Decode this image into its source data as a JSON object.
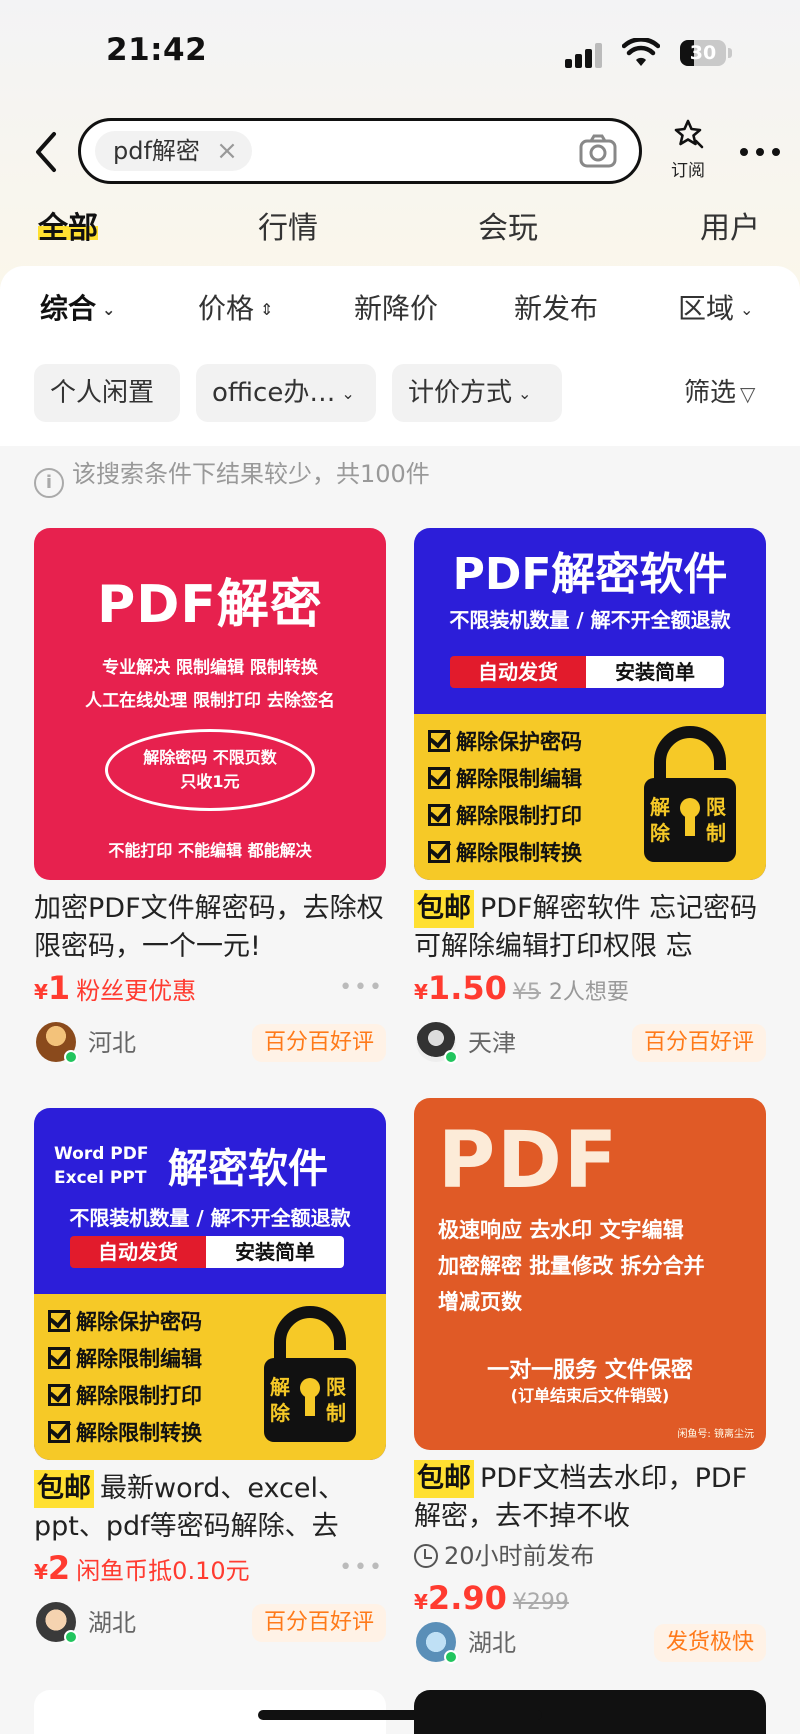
{
  "status_bar": {
    "time": "21:42",
    "battery": "30",
    "battery_level": 0.3
  },
  "search": {
    "query": "pdf解密",
    "clear_glyph": "×"
  },
  "subscribe_label": "订阅",
  "tabs": [
    {
      "label": "全部",
      "active": true
    },
    {
      "label": "行情"
    },
    {
      "label": "会玩"
    },
    {
      "label": "用户"
    }
  ],
  "sort": [
    {
      "label": "综合",
      "caret": "⌄",
      "active": true
    },
    {
      "label": "价格",
      "caret": "⇕"
    },
    {
      "label": "新降价"
    },
    {
      "label": "新发布"
    },
    {
      "label": "区域",
      "caret": "⌄"
    }
  ],
  "filters": [
    {
      "label": "个人闲置"
    },
    {
      "label": "office办…",
      "caret": "⌄"
    },
    {
      "label": "计价方式",
      "caret": "⌄"
    }
  ],
  "filter_button": {
    "label": "筛选",
    "icon": "▽"
  },
  "notice": "该搜索条件下结果较少，共100件",
  "products": [
    {
      "title": "加密PDF文件解密码，去除权限密码，一个一元!",
      "price": "1",
      "price_note": "粉丝更优惠",
      "location": "河北",
      "badge": "百分百好评",
      "image": {
        "headline": "PDF解密",
        "line1": "专业解决 限制编辑 限制转换",
        "line2": "人工在线处理 限制打印 去除签名",
        "ellipse1": "解除密码 不限页数",
        "ellipse2": "只收1元",
        "bottom": "不能打印 不能编辑 都能解决"
      }
    },
    {
      "free_shipping": "包邮",
      "title": "PDF解密软件 忘记密码可解除编辑打印权限 忘",
      "price": "1.50",
      "original_price": "¥5",
      "wants": "2人想要",
      "location": "天津",
      "badge": "百分百好评",
      "image": {
        "headline": "PDF解密软件",
        "sub": "不限装机数量 / 解不开全额退款",
        "btn_red": "自动发货",
        "btn_white": "安装简单",
        "checks": [
          "解除保护密码",
          "解除限制编辑",
          "解除限制打印",
          "解除限制转换"
        ],
        "lock_left": "解除",
        "lock_right": "限制"
      }
    },
    {
      "free_shipping": "包邮",
      "title": "最新word、excel、ppt、pdf等密码解除、去",
      "price": "2",
      "price_note": "闲鱼币抵0.10元",
      "location": "湖北",
      "badge": "百分百好评",
      "image": {
        "small_line1": "Word PDF",
        "small_line2": "Excel PPT",
        "headline": "解密软件",
        "sub": "不限装机数量 / 解不开全额退款",
        "btn_red": "自动发货",
        "btn_white": "安装简单",
        "checks": [
          "解除保护密码",
          "解除限制编辑",
          "解除限制打印",
          "解除限制转换"
        ],
        "lock_left": "解除",
        "lock_right": "限制"
      }
    },
    {
      "free_shipping": "包邮",
      "title": "PDF文档去水印，PDF解密，去不掉不收",
      "time_tag": "20小时前发布",
      "price": "2.90",
      "original_price": "¥299",
      "location": "湖北",
      "badge": "发货极快",
      "image": {
        "headline": "PDF",
        "row1": "极速响应  去水印  文字编辑",
        "row2": "加密解密 批量修改 拆分合并",
        "row3": "增减页数",
        "service": "一对一服务  文件保密",
        "service_note": "(订单结束后文件销毁)",
        "corner": "闲鱼号: 镜离尘沅"
      }
    }
  ],
  "currency": "¥",
  "more_glyph": "•••",
  "colors": {
    "price": "#ff3b30",
    "highlight": "#ffe031",
    "badge_text": "#ff7a1a"
  }
}
